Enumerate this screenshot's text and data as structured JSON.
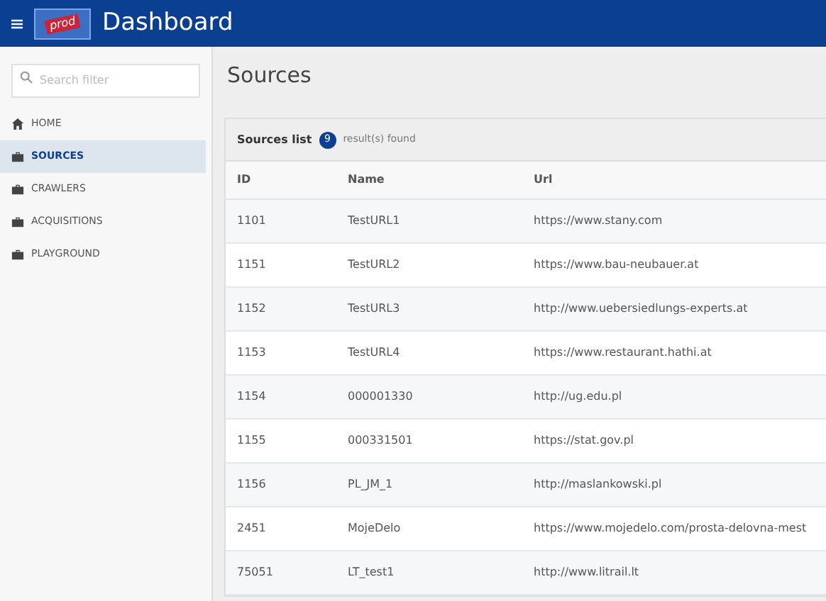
{
  "header": {
    "title": "Dashboard",
    "logo_badge": "prod"
  },
  "sidebar": {
    "search": {
      "placeholder": "Search filter"
    },
    "items": [
      {
        "label": "HOME",
        "kind": "home",
        "selected": false
      },
      {
        "label": "SOURCES",
        "kind": "section",
        "selected": true
      },
      {
        "label": "CRAWLERS",
        "kind": "section",
        "selected": false
      },
      {
        "label": "ACQUISITIONS",
        "kind": "section",
        "selected": false
      },
      {
        "label": "PLAYGROUND",
        "kind": "section",
        "selected": false
      }
    ]
  },
  "page_title": "Sources",
  "card": {
    "title": "Sources list",
    "count": "9",
    "count_label": "result(s) found"
  },
  "table": {
    "columns": [
      "ID",
      "Name",
      "Url"
    ],
    "rows": [
      [
        "1101",
        "TestURL1",
        "https://www.stany.com"
      ],
      [
        "1151",
        "TestURL2",
        "https://www.bau-neubauer.at"
      ],
      [
        "1152",
        "TestURL3",
        "http://www.uebersiedlungs-experts.at"
      ],
      [
        "1153",
        "TestURL4",
        "https://www.restaurant.hathi.at"
      ],
      [
        "1154",
        "000001330",
        "http://ug.edu.pl"
      ],
      [
        "1155",
        "000331501",
        "https://stat.gov.pl"
      ],
      [
        "1156",
        "PL_JM_1",
        "http://maslankowski.pl"
      ],
      [
        "2451",
        "MojeDelo",
        "https://www.mojedelo.com/prosta-delovna-mest"
      ],
      [
        "75051",
        "LT_test1",
        "http://www.litrail.lt"
      ]
    ]
  }
}
